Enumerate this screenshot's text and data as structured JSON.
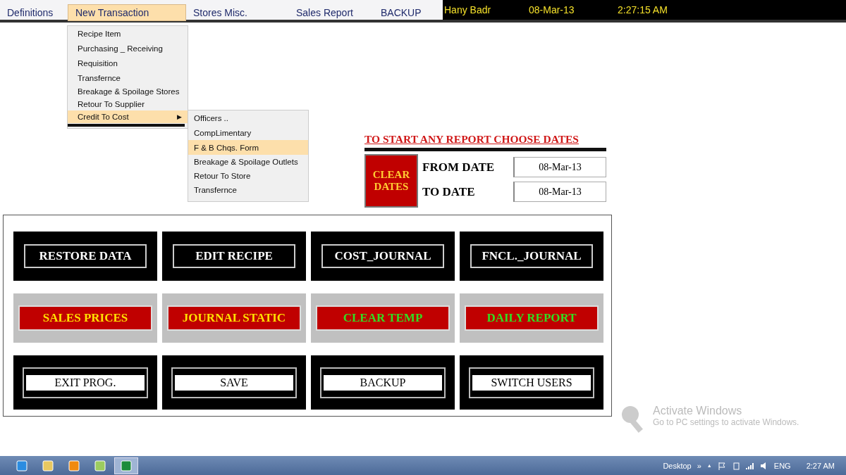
{
  "menu_bar": {
    "items": [
      {
        "label": "Definitions",
        "selected": false
      },
      {
        "label": "New Transaction",
        "selected": true
      },
      {
        "label": "Stores Misc.",
        "selected": false
      },
      {
        "label": "Sales Report",
        "selected": false
      },
      {
        "label": "BACKUP",
        "selected": false
      }
    ],
    "user": "Hany Badr",
    "date": "08-Mar-13",
    "time": "2:27:15 AM"
  },
  "dropdown": {
    "items": [
      {
        "label": "Recipe Item",
        "selected": false
      },
      {
        "label": "Purchasing _ Receiving",
        "selected": false
      },
      {
        "label": "Requisition",
        "selected": false
      },
      {
        "label": "Transfernce",
        "selected": false
      },
      {
        "label": "Breakage & Spoilage Stores",
        "selected": false
      },
      {
        "label": "Retour To Supplier",
        "selected": false
      },
      {
        "label": "Credit To Cost",
        "selected": true,
        "arrow": "▶",
        "children": [
          {
            "label": "Officers  ..",
            "selected": false
          },
          {
            "label": "CompLimentary",
            "selected": false
          },
          {
            "label": "F & B Chqs. Form",
            "selected": true
          },
          {
            "label": "Breakage & Spoilage Outlets",
            "selected": false
          },
          {
            "label": "Retour To Store",
            "selected": false
          },
          {
            "label": "Transfernce",
            "selected": false
          }
        ]
      }
    ]
  },
  "dates": {
    "title": "TO START ANY REPORT CHOOSE DATES",
    "clear_button": "CLEAR DATES",
    "fields": [
      {
        "label": "FROM DATE",
        "value": "08-Mar-13"
      },
      {
        "label": "TO DATE",
        "value": "08-Mar-13"
      }
    ]
  },
  "buttons": [
    {
      "label": "RESTORE DATA",
      "kind": "outline"
    },
    {
      "label": "EDIT RECIPE",
      "kind": "outline"
    },
    {
      "label": "COST_JOURNAL",
      "kind": "outline"
    },
    {
      "label": "FNCL._JOURNAL",
      "kind": "outline"
    },
    {
      "label": "SALES PRICES",
      "kind": "yellowtext"
    },
    {
      "label": "JOURNAL STATIC",
      "kind": "yellowtext"
    },
    {
      "label": "CLEAR TEMP",
      "kind": "greentext"
    },
    {
      "label": "DAILY REPORT",
      "kind": "greentext"
    },
    {
      "label": "EXIT PROG.",
      "kind": "plain"
    },
    {
      "label": "SAVE",
      "kind": "plain"
    },
    {
      "label": "BACKUP",
      "kind": "plain"
    },
    {
      "label": "SWITCH USERS",
      "kind": "plain"
    }
  ],
  "activation_notice": {
    "title": "Activate Windows",
    "subtitle": "Go to PC settings to activate Windows."
  },
  "taskbar": {
    "apps": [
      {
        "kind": "browser",
        "selected": false
      },
      {
        "kind": "folder",
        "selected": false
      },
      {
        "kind": "media",
        "selected": false
      },
      {
        "kind": "note",
        "selected": false
      },
      {
        "kind": "excel",
        "selected": true
      }
    ],
    "toolbar": "Desktop",
    "chevron": "»",
    "tray_arrow": "▲",
    "language": "ENG",
    "clock": "2:27 AM"
  }
}
